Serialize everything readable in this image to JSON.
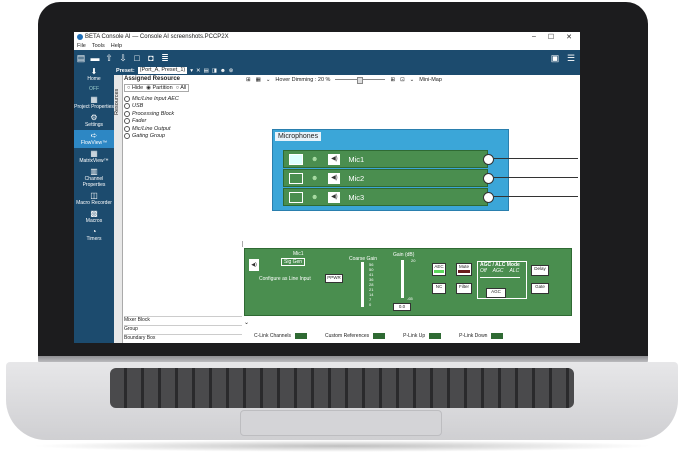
{
  "window": {
    "title": "BETA Console AI  — Console AI screenshots.PCCP2X",
    "controls": [
      "–",
      "☐",
      "✕"
    ]
  },
  "menu": [
    "File",
    "Tools",
    "Help"
  ],
  "toolbar": {
    "icons": [
      "graph-icon",
      "open-icon",
      "upload-icon",
      "download-icon",
      "new-icon",
      "preview-icon",
      "list-icon"
    ]
  },
  "preset": {
    "label": "Preset:",
    "value": "(Port_A, Preset_1)"
  },
  "sidebar": {
    "items": [
      {
        "label": "Home",
        "icon": "⬇"
      },
      {
        "label": "OFF",
        "icon": ""
      },
      {
        "label": "Project Properties",
        "icon": "▦"
      },
      {
        "label": "Settings",
        "icon": "⚙"
      },
      {
        "label": "FlowView™",
        "icon": "➪"
      },
      {
        "label": "MatrixView™",
        "icon": "▦"
      },
      {
        "label": "Channel Properties",
        "icon": "▥"
      },
      {
        "label": "Macro Recorder",
        "icon": "◫"
      },
      {
        "label": "Macros",
        "icon": "▩"
      },
      {
        "label": "Timers",
        "icon": "◔"
      }
    ]
  },
  "resources": {
    "tab": "Resources",
    "heading": "Assigned Resource",
    "radios": [
      "Hide",
      "Partition",
      "All"
    ],
    "items": [
      "Mic/Line Input AEC",
      "USB",
      "Processing Block",
      "Fader",
      "Mic/Line Output",
      "Gating Group"
    ],
    "bottom": [
      "Mixer Block",
      "Group",
      "Boundary Box"
    ]
  },
  "canvas": {
    "hover_label": "Hover Dimming :  20 %",
    "minimap_label": "Mini-Map",
    "group_title": "Microphones",
    "mics": [
      "Mic1",
      "Mic2",
      "Mic3"
    ]
  },
  "dsp": {
    "channel": "Mic1",
    "sig_gen": "Sig Gen",
    "configure": "Configure as Line Input",
    "ppwr": "PPWR",
    "coarse": "Coarse Gain",
    "coarse_ticks": [
      "56",
      "50",
      "41",
      "36",
      "28",
      "21",
      "14",
      "7",
      "0"
    ],
    "gain": "Gain  (dB)",
    "gain_top": "20",
    "gain_bottom": "-65",
    "gain_value": "0.0",
    "aec": "AEC",
    "mute": "Mute",
    "nc": "NC",
    "filter": "Filter",
    "agc_title": "AGC / ALC Mode",
    "agc_modes": [
      "Off",
      "AGC",
      "ALC"
    ],
    "agc": "AGC",
    "delay": "Delay",
    "gate": "Gate"
  },
  "status": [
    {
      "label": "C-Link Channels"
    },
    {
      "label": "Custom References"
    },
    {
      "label": "P-Link Up"
    },
    {
      "label": "P-Link Down"
    }
  ]
}
